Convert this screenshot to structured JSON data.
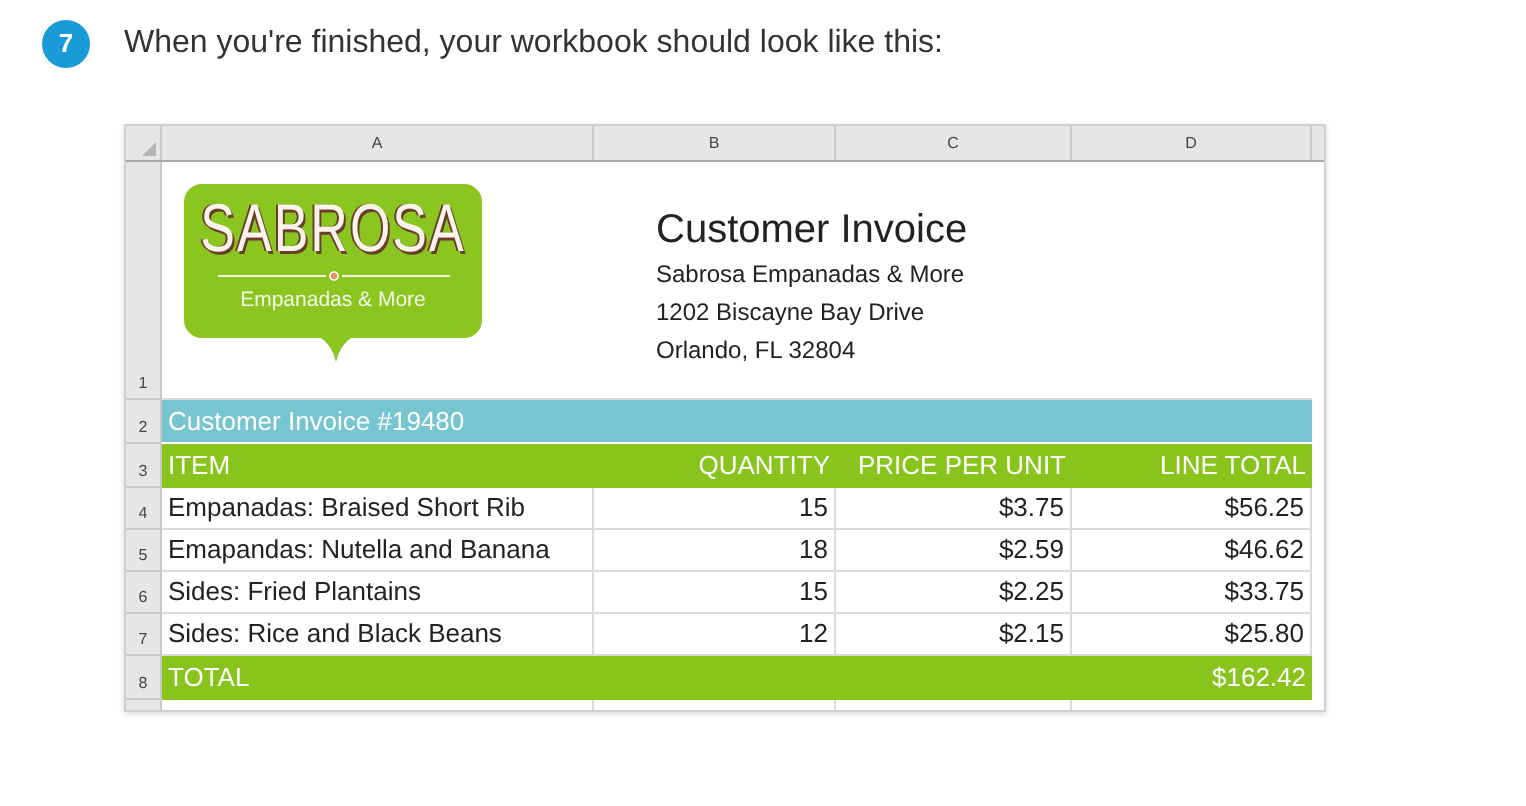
{
  "step": {
    "number": "7",
    "text": "When you're finished, your workbook should look like this:"
  },
  "sheet": {
    "column_headers": [
      "A",
      "B",
      "C",
      "D"
    ],
    "row_numbers": [
      "1",
      "2",
      "3",
      "4",
      "5",
      "6",
      "7",
      "8"
    ],
    "logo": {
      "wordmark": "SABROSA",
      "tagline": "Empanadas & More"
    },
    "title": "Customer Invoice",
    "address_lines": [
      "Sabrosa Empanadas & More",
      "1202 Biscayne Bay Drive",
      "Orlando, FL 32804"
    ],
    "banner": "Customer Invoice #19480",
    "columns": [
      "ITEM",
      "QUANTITY",
      "PRICE PER UNIT",
      "LINE TOTAL"
    ],
    "rows": [
      {
        "item": "Empanadas: Braised Short Rib",
        "quantity": "15",
        "price": "$3.75",
        "total": "$56.25"
      },
      {
        "item": "Emapandas: Nutella and Banana",
        "quantity": "18",
        "price": "$2.59",
        "total": "$46.62"
      },
      {
        "item": "Sides: Fried Plantains",
        "quantity": "15",
        "price": "$2.25",
        "total": "$33.75"
      },
      {
        "item": "Sides: Rice and Black Beans",
        "quantity": "12",
        "price": "$2.15",
        "total": "$25.80"
      }
    ],
    "total": {
      "label": "TOTAL",
      "value": "$162.42"
    }
  }
}
